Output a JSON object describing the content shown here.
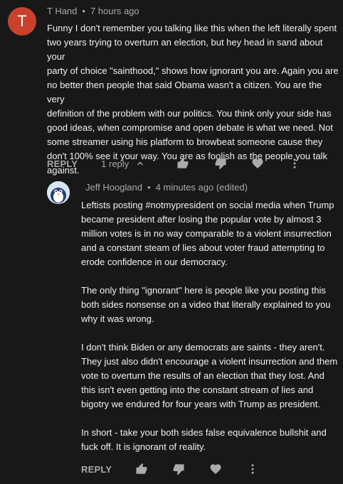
{
  "comment": {
    "author": "T Hand",
    "avatar_letter": "T",
    "timestamp": "7 hours ago",
    "text": "Funny I don't remember you talking like this when the left literally spent\ntwo years trying to overturn an election, but hey head in sand about your\nparty of choice \"sainthood,\" shows how ignorant you are. Again you are\nno better then people that said Obama wasn't a citizen. You are the very\ndefinition of the problem with our politics.  You think only your side has\ngood ideas, when compromise and open debate is what we need. Not\nsome streamer using his platform to browbeat someone cause they\ndon't 100% see it your way. You are as foolish as the people you talk\nagainst.",
    "reply_label": "REPLY",
    "replies_count_label": "1 reply"
  },
  "reply": {
    "author": "Jeff Hoogland",
    "timestamp": "4 minutes ago (edited)",
    "text": "Leftists posting #notmypresident on social media when Trump\nbecame president after losing the popular vote by almost 3\nmillion votes is in no way comparable to a violent insurrection\nand a constant steam of lies about voter fraud attempting to\nerode confidence in our democracy.\n\nThe only thing \"ignorant\" here is people like you posting this\nboth sides nonsense on a video that literally explained to you\nwhy it was wrong.\n\nI don't think Biden or any democrats are saints - they aren't.\nThey just also didn't encourage a violent insurrection and them\nvote to overturn the results of an election that they lost. And\nthis isn't even getting into the constant stream of lies and\nbigotry we endured for four years with Trump as president.\n\nIn short - take your both sides false equivalence bullshit and\nfuck off. It is ignorant of reality.",
    "reply_label": "REPLY"
  },
  "separator": "•"
}
